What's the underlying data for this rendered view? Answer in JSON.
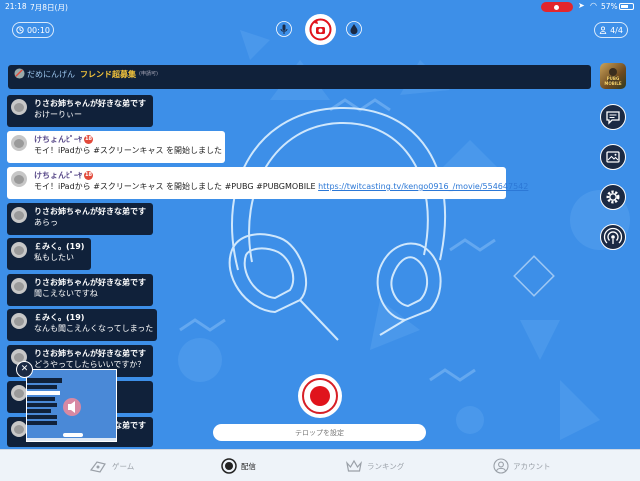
{
  "status_bar": {
    "time": "21:18",
    "date": "7月8日(月)",
    "battery": "57%"
  },
  "top_bar": {
    "timer": "00:10",
    "viewers": "4/4"
  },
  "banner": {
    "name": "だめにんげん",
    "tag": "フレンド超募集",
    "tag_sub": "(申請可)"
  },
  "game": {
    "title": "PUBG MOBILE"
  },
  "comments": [
    {
      "name": "りさお姉ちゃんが好きな弟です",
      "text": "おけーりぃー",
      "style": "dark"
    },
    {
      "name": "けちょんﾋﾟｰﾔ",
      "badge": "18",
      "text": "モイ！iPadから #スクリーンキャス を開始しました",
      "style": "light"
    },
    {
      "name": "けちょんﾋﾟｰﾔ",
      "badge": "18",
      "text": "モイ！iPadから #スクリーンキャス を開始しました  #PUBG  #PUBGMOBILE ",
      "link": "https://twitcasting.tv/kengo0916_/movie/554647542",
      "style": "light"
    },
    {
      "name": "りさお姉ちゃんが好きな弟です",
      "text": "あらっ",
      "style": "dark"
    },
    {
      "name": "￡みく。(19)",
      "text": "私もしたい",
      "style": "dark"
    },
    {
      "name": "りさお姉ちゃんが好きな弟です",
      "text": "聞こえないですね",
      "style": "dark"
    },
    {
      "name": "￡みく。(19)",
      "text": "なんも聞こえんくなってしまった",
      "style": "dark"
    },
    {
      "name": "りさお姉ちゃんが好きな弟です",
      "text": "どうやってしたらいいですか？",
      "style": "dark"
    },
    {
      "name": "",
      "text": "",
      "style": "dark"
    },
    {
      "name": "りさお姉ちゃんが好きな弟です",
      "text": "",
      "style": "dark"
    }
  ],
  "caption": {
    "placeholder": "テロップを設定"
  },
  "tabs": [
    {
      "label": "ゲーム",
      "icon": "game-icon",
      "active": false
    },
    {
      "label": "配信",
      "icon": "broadcast-icon",
      "active": true
    },
    {
      "label": "ランキング",
      "icon": "crown-icon",
      "active": false
    },
    {
      "label": "アカウント",
      "icon": "account-icon",
      "active": false
    }
  ],
  "colors": {
    "background": "#3d8fe8",
    "record": "#e0141c",
    "comment_dark": "#10213a",
    "banner_tag": "#f4c43a"
  }
}
